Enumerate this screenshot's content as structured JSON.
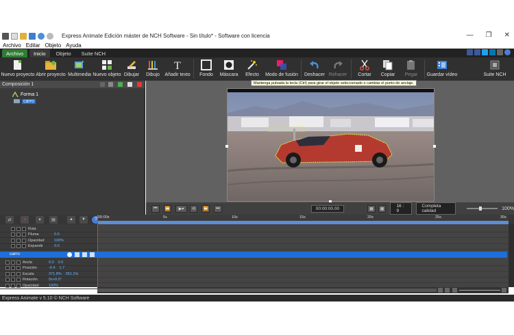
{
  "window": {
    "title": "Express Animate Edición máster de NCH Software - Sin título* - Software con licencia",
    "controls": [
      "—",
      "❐",
      "✕"
    ]
  },
  "menu": [
    "Archivo",
    "Editar",
    "Objeto",
    "Ayuda"
  ],
  "tabs": [
    {
      "label": "Archivo",
      "state": "active"
    },
    {
      "label": "Inicio",
      "state": "selected"
    },
    {
      "label": "Objeto",
      "state": "normal"
    },
    {
      "label": "Suite NCH",
      "state": "normal"
    }
  ],
  "toolbar": [
    {
      "label": "Nuevo proyecto",
      "icon": "new-project-icon"
    },
    {
      "label": "Abrir proyecto",
      "icon": "open-folder-icon"
    },
    {
      "label": "Multimedia",
      "icon": "multimedia-icon"
    },
    {
      "label": "Nuevo objeto",
      "icon": "new-object-icon"
    },
    {
      "label": "Dibujar",
      "icon": "draw-icon"
    },
    {
      "label": "Dibujo",
      "icon": "drawing-icon"
    },
    {
      "label": "Añadir texto",
      "icon": "text-icon"
    },
    {
      "label": "Fondo",
      "icon": "background-icon"
    },
    {
      "label": "Máscara",
      "icon": "mask-icon"
    },
    {
      "label": "Efecto",
      "icon": "effect-icon"
    },
    {
      "label": "Modo de fusión",
      "icon": "blend-mode-icon"
    },
    {
      "label": "Deshacer",
      "icon": "undo-icon"
    },
    {
      "label": "Rehacer",
      "icon": "redo-icon"
    },
    {
      "label": "Cortar",
      "icon": "cut-icon"
    },
    {
      "label": "Copiar",
      "icon": "copy-icon"
    },
    {
      "label": "Pegar",
      "icon": "paste-icon"
    },
    {
      "label": "Guardar vídeo",
      "icon": "save-video-icon"
    },
    {
      "label": "Suite NCH",
      "icon": "nch-suite-icon"
    }
  ],
  "composition": {
    "label": "Composición 1",
    "tree": [
      "Forma 1",
      "carro"
    ]
  },
  "tooltip": "Mantenga pulsada la tecla (Ctrl) para girar el objeto seleccionado o cambiar el punto de anclaje.",
  "transport": {
    "time": "00:00:00.00",
    "aspect": "16 : 9",
    "quality": "Completa calidad",
    "zoom": "100%"
  },
  "timeline": {
    "ruler": [
      "00:00s",
      "5s",
      "10s",
      "15s",
      "20s",
      "25s",
      "30s"
    ],
    "group1": [
      {
        "name": "Ruta",
        "values": []
      },
      {
        "name": "Pluma",
        "values": [
          "0.0"
        ]
      },
      {
        "name": "Opacidad",
        "values": [
          "100%"
        ]
      },
      {
        "name": "Expandir",
        "values": [
          "0.0"
        ]
      }
    ],
    "layer_label": "carro",
    "group2": [
      {
        "name": "Ancla",
        "values": [
          "0.0",
          "0.0"
        ]
      },
      {
        "name": "Posición",
        "values": [
          "-0.4",
          "1.7"
        ]
      },
      {
        "name": "Escala",
        "values": [
          "371.8%",
          "351.1%"
        ]
      },
      {
        "name": "Rotación",
        "values": [
          "0x+0.0°"
        ]
      },
      {
        "name": "Opacidad",
        "values": [
          "100%"
        ]
      }
    ]
  },
  "status": "Express Animate v 5.10 © NCH Software"
}
